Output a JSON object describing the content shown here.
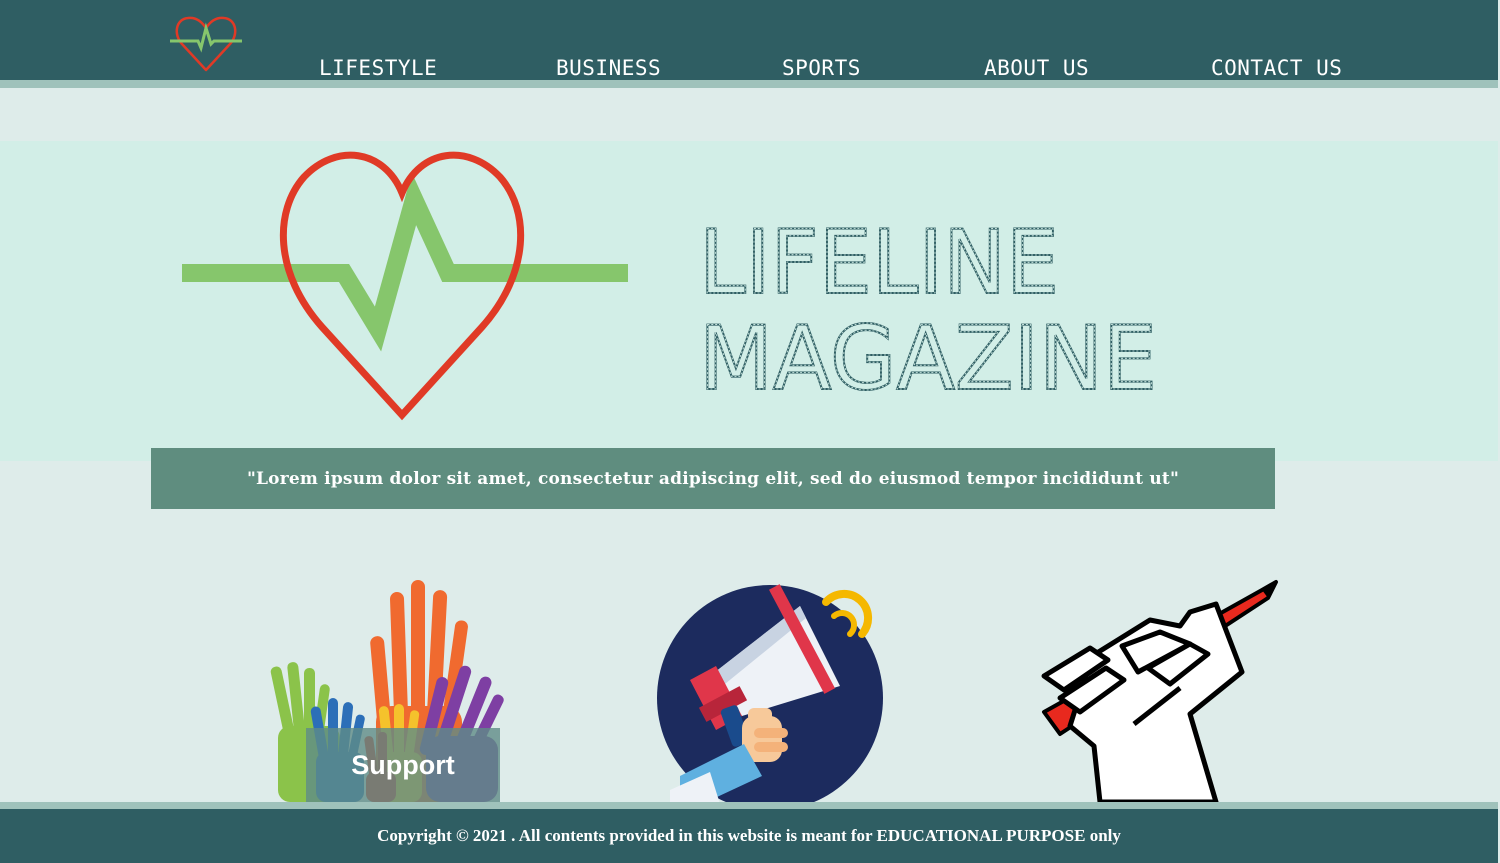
{
  "nav": {
    "items": [
      {
        "label": "LIFESTYLE"
      },
      {
        "label": "BUSINESS"
      },
      {
        "label": "SPORTS"
      },
      {
        "label": "ABOUT US"
      },
      {
        "label": "CONTACT US"
      }
    ]
  },
  "hero": {
    "title_line1": "LIFELINE",
    "title_line2": "MAGAZINE",
    "logo_icon": "heartbeat-heart-icon"
  },
  "quote": {
    "text": "\"Lorem ipsum dolor sit amet, consectetur adipiscing elit, sed do eiusmod tempor incididunt ut\""
  },
  "cards": {
    "support_label": "Support",
    "icons": [
      "raised-hands-icon",
      "megaphone-icon",
      "fist-pen-icon"
    ]
  },
  "footer": {
    "text": "Copyright © 2021 . All contents provided in this website is meant for EDUCATIONAL PURPOSE only"
  },
  "colors": {
    "header_bg": "#2f5e63",
    "stripe": "#9fc2bb",
    "page_bg": "#deecea",
    "hero_bg": "#d2eee7",
    "quote_bg": "#5f8d7f",
    "heart_red": "#e03a26",
    "pulse_green": "#86c66c",
    "title_teal": "#2f5e63"
  }
}
